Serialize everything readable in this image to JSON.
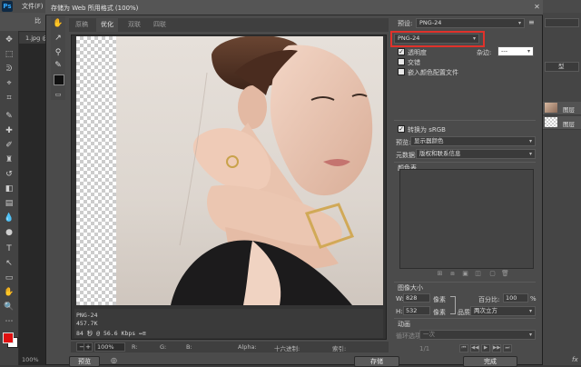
{
  "ps": {
    "logo": "Ps",
    "menu": [
      "文件(F)",
      "比"
    ],
    "doc_tab": "1.jpg @",
    "zoom": "100%",
    "panel_labels": [
      "型",
      "图层",
      "图层"
    ],
    "fx": "fx"
  },
  "dialog": {
    "title": "存储为 Web 所用格式 (100%)",
    "tabs": [
      "原稿",
      "优化",
      "双联",
      "四联"
    ],
    "active_tab": 1,
    "preview_info": [
      "PNG-24",
      "457.7K",
      "84 秒 @ 56.6 Kbps ↔≡"
    ],
    "bottom_bar": {
      "zoom": "100%",
      "r": "R:",
      "g": "G:",
      "b": "B:",
      "alpha": "Alpha:",
      "hex": "十六进制:",
      "index": "索引:"
    },
    "buttons": {
      "preview": "预览",
      "save": "存储",
      "done": "完成"
    },
    "settings": {
      "preset_label": "预设:",
      "preset_value": "PNG-24",
      "format_value": "PNG-24",
      "transparency_label": "透明度",
      "matte_label": "杂边:",
      "matte_value": "---",
      "interlaced_label": "交错",
      "embed_profile_label": "嵌入颜色配置文件",
      "convert_srgb_label": "转换为 sRGB",
      "preview_label": "预览:",
      "preview_value": "显示器颜色",
      "metadata_label": "元数据:",
      "metadata_value": "版权和联系信息",
      "color_table_label": "颜色表",
      "image_size_label": "图像大小",
      "w_label": "W:",
      "w_value": "828",
      "h_label": "H:",
      "h_value": "532",
      "px_unit": "像素",
      "percent_label": "百分比:",
      "percent_value": "100",
      "percent_unit": "%",
      "quality_label": "品质:",
      "quality_value": "两次立方",
      "animation_label": "动画",
      "loop_label": "循环选项:",
      "loop_value": "一次",
      "frame_counter": "1/1"
    },
    "checkbox_states": {
      "transparency": true,
      "interlaced": false,
      "embed_profile": false,
      "convert_srgb": true
    }
  },
  "colors": {
    "accent_red": "#e0322b",
    "foreground_color": "#e01010",
    "background_color": "#ffffff",
    "ps_blue": "#31a8ff"
  }
}
